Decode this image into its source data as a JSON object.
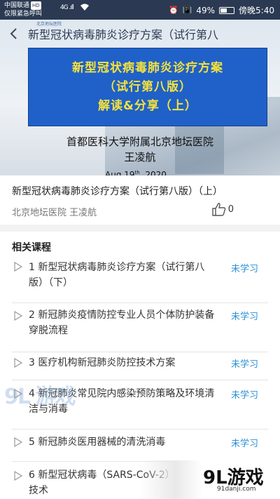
{
  "status_bar": {
    "carrier_line1": "中国联通",
    "carrier_hd": "HD",
    "carrier_line2": "仅限紧急呼叫",
    "signal": "4G .ıll",
    "battery_percent_text": "49%",
    "battery_level": 0.49,
    "time": "傍晚5:40"
  },
  "header": {
    "title": "新型冠状病毒肺炎诊疗方案（试行第八",
    "logo_text": "北京地坛医院"
  },
  "hero": {
    "banner_lines": [
      "新型冠状病毒肺炎诊疗方案",
      "（试行第八版）",
      "解读&分享（上）"
    ],
    "organization": "首都医科大学附属北京地坛医院",
    "speaker": "王凌航",
    "date_prefix": "Aug 19",
    "date_sup": "th",
    "date_suffix": ", 2020"
  },
  "course": {
    "title": "新型冠状病毒肺炎诊疗方案（试行第八版）（上）",
    "meta": "北京地坛医院 王凌航",
    "likes": "0"
  },
  "related": {
    "heading": "相关课程",
    "items": [
      {
        "text": "1 新型冠状病毒肺炎诊疗方案（试行第八版）（下）",
        "status": "未学习"
      },
      {
        "text": "2 新冠肺炎疫情防控专业人员个体防护装备穿脱流程",
        "status": "未学习"
      },
      {
        "text": "3 医疗机构新冠肺炎防控技术方案",
        "status": "未学习"
      },
      {
        "text": "4 新冠肺炎常见院内感染预防策略及环境清洁与消毒",
        "status": "未学习"
      },
      {
        "text": "5 新冠肺炎医用器械的清洗消毒",
        "status": "未学习"
      },
      {
        "text": "6 新型冠状病毒（SARS-CoV-2）核酸检测技术",
        "status": ""
      }
    ]
  },
  "watermark": {
    "left": "9L 游戏",
    "right": "9L游戏",
    "site": "91danji.com"
  }
}
